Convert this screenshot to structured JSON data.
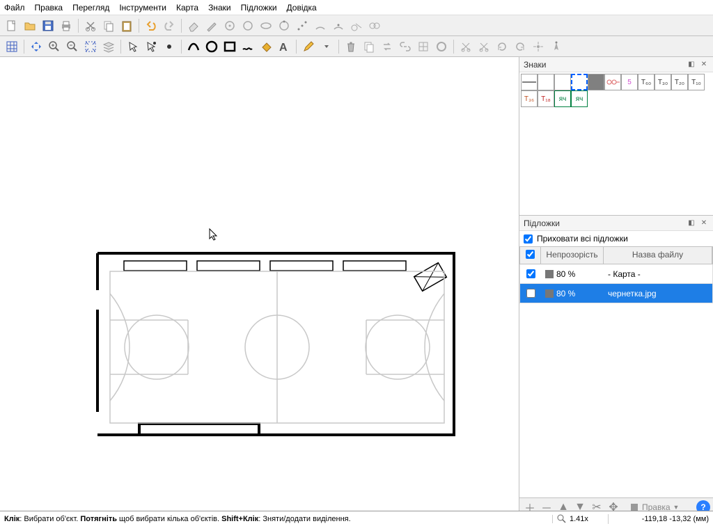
{
  "menubar": {
    "file": "Файл",
    "edit": "Правка",
    "view": "Перегляд",
    "tools": "Інструменти",
    "map": "Карта",
    "signs": "Знаки",
    "layers": "Підложки",
    "help": "Довідка"
  },
  "panels": {
    "signs": {
      "title": "Знаки",
      "items": [
        "",
        "",
        "",
        "sel",
        "dark",
        "~",
        "5",
        "T₆₀",
        "T₃₀",
        "T₂₀",
        "T₁₀",
        "T₃₆",
        "T₁₈",
        "яч",
        "яч"
      ]
    },
    "layers": {
      "title": "Підложки",
      "hide_all": "Приховати всі підложки",
      "columns": {
        "opacity": "Непрозорість",
        "name": "Назва файлу"
      },
      "rows": [
        {
          "checked": true,
          "opacity": "80 %",
          "name": "- Карта -",
          "selected": false
        },
        {
          "checked": false,
          "opacity": "80 %",
          "name": "чернетка.jpg",
          "selected": true
        }
      ],
      "edit_label": "Правка"
    }
  },
  "status": {
    "click": "Клік",
    "hint1": ": Вибрати об'єкт. ",
    "drag": "Потягніть",
    "hint2": " щоб вибрати кілька об'єктів. ",
    "shift": "Shift+Клік",
    "hint3": ": Зняти/додати виділення.",
    "zoom": "1.41x",
    "coord": "-119,18 -13,32 (мм)"
  }
}
